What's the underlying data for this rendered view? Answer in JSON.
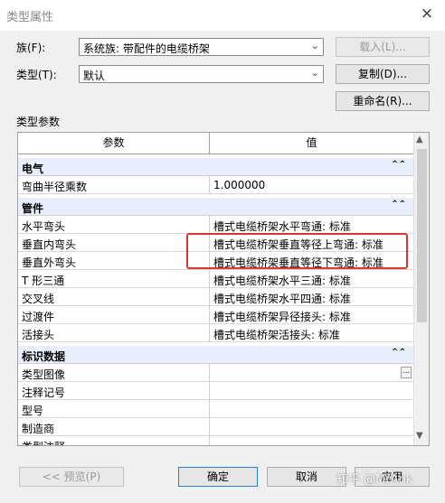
{
  "window": {
    "title": "类型属性",
    "close_glyph": "×"
  },
  "family": {
    "label": "族(F):",
    "value": "系统族: 带配件的电缆桥架",
    "load_button": "载入(L)..."
  },
  "type": {
    "label": "类型(T):",
    "value": "默认",
    "duplicate_button": "复制(D)...",
    "rename_button": "重命名(R)..."
  },
  "params": {
    "section_label": "类型参数",
    "col_param": "参数",
    "col_value": "值",
    "groups": {
      "electrical": {
        "title": "电气",
        "rows": [
          {
            "name": "弯曲半径乘数",
            "value": "1.000000"
          }
        ]
      },
      "fittings": {
        "title": "管件",
        "rows": [
          {
            "name": "水平弯头",
            "value": "槽式电缆桥架水平弯通: 标准"
          },
          {
            "name": "垂直内弯头",
            "value": "槽式电缆桥架垂直等径上弯通: 标准"
          },
          {
            "name": "垂直外弯头",
            "value": "槽式电缆桥架垂直等径下弯通: 标准"
          },
          {
            "name": "T 形三通",
            "value": "槽式电缆桥架水平三通: 标准"
          },
          {
            "name": "交叉线",
            "value": "槽式电缆桥架水平四通: 标准"
          },
          {
            "name": "过渡件",
            "value": "槽式电缆桥架异径接头: 标准"
          },
          {
            "name": "活接头",
            "value": "槽式电缆桥架活接头: 标准"
          }
        ]
      },
      "identity": {
        "title": "标识数据",
        "rows": [
          {
            "name": "类型图像",
            "value": ""
          },
          {
            "name": "注释记号",
            "value": ""
          },
          {
            "name": "型号",
            "value": ""
          },
          {
            "name": "制造商",
            "value": ""
          },
          {
            "name": "类型注释",
            "value": ""
          }
        ]
      }
    }
  },
  "footer": {
    "preview_button": "<< 预览(P)",
    "ok_button": "确定",
    "cancel_button": "取消",
    "apply_button": "应用"
  },
  "watermark": "知乎 @MrAnk",
  "colors": {
    "highlight": "#d9342f",
    "section_bg": "#e8eefb",
    "default_border": "#2e7ad6"
  },
  "icons": {
    "collapse": "double-chevron-up-icon",
    "dropdown": "chevron-down-icon",
    "more": "ellipsis-icon"
  }
}
